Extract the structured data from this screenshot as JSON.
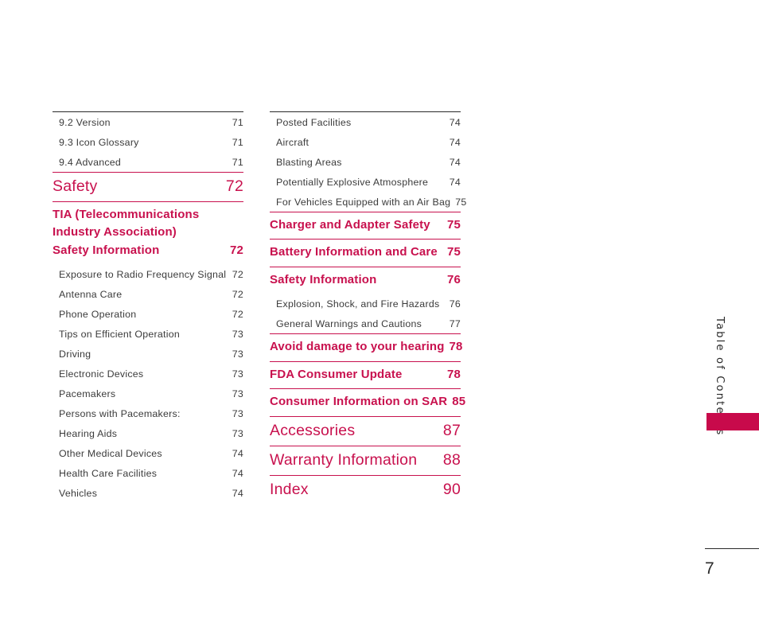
{
  "document": {
    "page_number": "7",
    "side_tab_label": "Table of Contents",
    "accent_color": "#C8114E",
    "tab_color": "#C80A4B",
    "body_color": "#3b3b3b"
  },
  "columns": [
    {
      "name": "left-column",
      "entries": [
        {
          "label": "9.2 Version",
          "page": "71",
          "style": "minor",
          "rule": "dark"
        },
        {
          "label": "9.3 Icon Glossary",
          "page": "71",
          "style": "minor",
          "rule": "none"
        },
        {
          "label": "9.4 Advanced",
          "page": "71",
          "style": "minor",
          "rule": "none"
        },
        {
          "label": "Safety",
          "page": "72",
          "style": "major-big",
          "rule": "mag"
        },
        {
          "label": "TIA (Telecommunications Industry Association) Safety Information",
          "page": "72",
          "style": "major-mid-multiline",
          "rule": "mag"
        },
        {
          "label": "Exposure to Radio Frequency Signal",
          "page": "72",
          "style": "minor",
          "rule": "none"
        },
        {
          "label": "Antenna Care",
          "page": "72",
          "style": "minor",
          "rule": "none"
        },
        {
          "label": "Phone Operation",
          "page": "72",
          "style": "minor",
          "rule": "none"
        },
        {
          "label": "Tips on Efficient Operation",
          "page": "73",
          "style": "minor",
          "rule": "none"
        },
        {
          "label": "Driving",
          "page": "73",
          "style": "minor",
          "rule": "none"
        },
        {
          "label": "Electronic Devices",
          "page": "73",
          "style": "minor",
          "rule": "none"
        },
        {
          "label": "Pacemakers",
          "page": "73",
          "style": "minor",
          "rule": "none"
        },
        {
          "label": "Persons with Pacemakers:",
          "page": "73",
          "style": "minor",
          "rule": "none"
        },
        {
          "label": "Hearing Aids",
          "page": "73",
          "style": "minor",
          "rule": "none"
        },
        {
          "label": "Other Medical Devices",
          "page": "74",
          "style": "minor",
          "rule": "none"
        },
        {
          "label": "Health Care Facilities",
          "page": "74",
          "style": "minor",
          "rule": "none"
        },
        {
          "label": "Vehicles",
          "page": "74",
          "style": "minor",
          "rule": "none"
        }
      ]
    },
    {
      "name": "right-column",
      "entries": [
        {
          "label": "Posted Facilities",
          "page": "74",
          "style": "minor",
          "rule": "dark"
        },
        {
          "label": "Aircraft",
          "page": "74",
          "style": "minor",
          "rule": "none"
        },
        {
          "label": "Blasting Areas",
          "page": "74",
          "style": "minor",
          "rule": "none"
        },
        {
          "label": "Potentially Explosive Atmosphere",
          "page": "74",
          "style": "minor",
          "rule": "none"
        },
        {
          "label": "For Vehicles Equipped with an Air Bag",
          "page": "75",
          "style": "minor",
          "rule": "none"
        },
        {
          "label": "Charger and Adapter Safety",
          "page": "75",
          "style": "major-mid",
          "rule": "mag"
        },
        {
          "label": "Battery Information and Care",
          "page": "75",
          "style": "major-mid",
          "rule": "mag"
        },
        {
          "label": "Safety Information",
          "page": "76",
          "style": "major-mid",
          "rule": "mag"
        },
        {
          "label": "Explosion, Shock, and Fire Hazards",
          "page": "76",
          "style": "minor",
          "rule": "none"
        },
        {
          "label": "General Warnings and Cautions",
          "page": "77",
          "style": "minor",
          "rule": "none"
        },
        {
          "label": "Avoid damage to your hearing",
          "page": "78",
          "style": "major-mid",
          "rule": "mag"
        },
        {
          "label": "FDA Consumer Update",
          "page": "78",
          "style": "major-mid",
          "rule": "mag"
        },
        {
          "label": "Consumer Information on SAR",
          "page": "85",
          "style": "major-mid",
          "rule": "mag"
        },
        {
          "label": "Accessories",
          "page": "87",
          "style": "major-big",
          "rule": "mag"
        },
        {
          "label": "Warranty Information",
          "page": "88",
          "style": "major-big",
          "rule": "mag"
        },
        {
          "label": "Index",
          "page": "90",
          "style": "major-big",
          "rule": "mag"
        }
      ]
    }
  ]
}
